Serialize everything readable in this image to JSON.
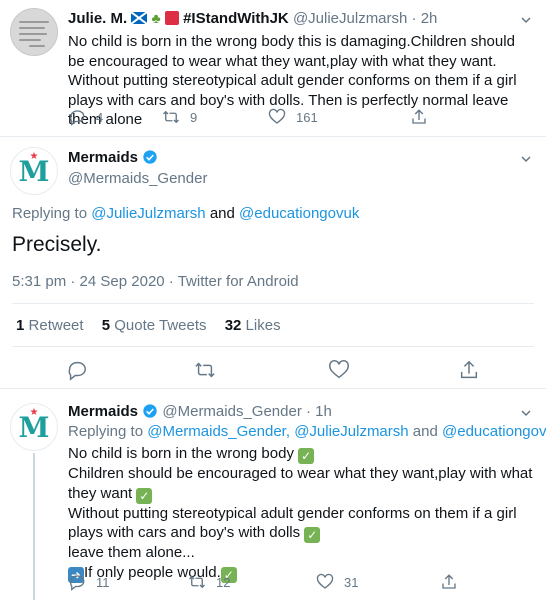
{
  "tweet1": {
    "display_name": "Julie. M.",
    "flag_emojis": [
      "scotland-flag",
      "shamrock",
      "red-square"
    ],
    "hashtag_name": "#IStandWithJK",
    "handle": "@JulieJulzmarsh",
    "sep": "·",
    "time": "2h",
    "text": "No child is born in the wrong body this is damaging.Children should be encouraged to wear what they want,play with what they want. Without putting stereotypical adult gender conforms on them if a girl plays with cars and boy's with dolls. Then is perfectly normal leave them alone",
    "replies": "4",
    "retweets": "9",
    "likes": "161"
  },
  "main_tweet": {
    "display_name": "Mermaids",
    "handle": "@Mermaids_Gender",
    "replying_prefix": "Replying to",
    "replying_user1": "@JulieJulzmarsh",
    "replying_and": "and",
    "replying_user2": "@educationgovuk",
    "text": "Precisely.",
    "time": "5:31 pm",
    "date": "24 Sep 2020",
    "client": "Twitter for Android",
    "retweets_count": "1",
    "retweets_label": "Retweet",
    "quotes_count": "5",
    "quotes_label": "Quote Tweets",
    "likes_count": "32",
    "likes_label": "Likes"
  },
  "reply_tweet": {
    "display_name": "Mermaids",
    "handle": "@Mermaids_Gender",
    "time": "1h",
    "replying_prefix": "Replying to",
    "replying_user1": "@Mermaids_Gender,",
    "replying_user2": "@JulieJulzmarsh",
    "replying_and": "and",
    "replying_user3": "@educationgovuk",
    "line1": "No child is born in the wrong body",
    "line2": "Children should be encouraged to wear what they want,play with what they want",
    "line3": "Without putting stereotypical adult gender conforms on them if a girl plays with cars and boy's with dolls",
    "line4": "leave them alone...",
    "line5": "If only people would.",
    "replies": "11",
    "retweets": "12",
    "likes": "31"
  },
  "colors": {
    "link": "#1b95e0",
    "muted": "#657786",
    "verified": "#1da1f2",
    "mermaids_teal": "#1f9e9e"
  }
}
